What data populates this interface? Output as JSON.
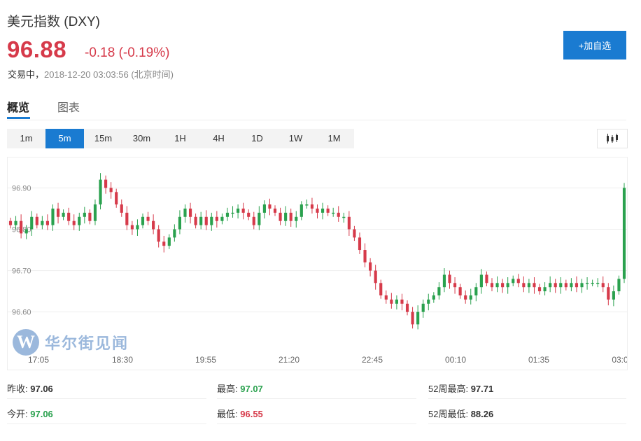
{
  "header": {
    "title": "美元指数 (DXY)",
    "price": "96.88",
    "change": "-0.18 (-0.19%)",
    "status_label": "交易中，",
    "timestamp": "2018-12-20 03:03:56 (北京时间)",
    "add_button": "+加自选"
  },
  "tabs": [
    {
      "label": "概览"
    },
    {
      "label": "图表"
    }
  ],
  "periods": [
    "1m",
    "5m",
    "15m",
    "30m",
    "1H",
    "4H",
    "1D",
    "1W",
    "1M"
  ],
  "active_period": "5m",
  "watermark": {
    "logo_letter": "W",
    "text": "华尔街见闻"
  },
  "colors": {
    "up": "#2aa14e",
    "down": "#d63a4a",
    "accent": "#1a7bd1",
    "price": "#d63a4a"
  },
  "stats": {
    "prev_close_label": "昨收:",
    "prev_close": "97.06",
    "open_label": "今开:",
    "open": "97.06",
    "high_label": "最高:",
    "high": "97.07",
    "low_label": "最低:",
    "low": "96.55",
    "high52_label": "52周最高:",
    "high52": "97.71",
    "low52_label": "52周最低:",
    "low52": "88.26"
  },
  "chart_data": {
    "type": "candlestick",
    "y_ticks": [
      "96.90",
      "96.80",
      "96.70",
      "96.60"
    ],
    "x_ticks": [
      "17:05",
      "18:30",
      "19:55",
      "21:20",
      "22:45",
      "00:10",
      "01:35",
      "03:0"
    ],
    "ylim": [
      96.53,
      96.96
    ],
    "grid": true,
    "closes": [
      96.81,
      96.82,
      96.79,
      96.8,
      96.83,
      96.81,
      96.82,
      96.81,
      96.85,
      96.83,
      96.84,
      96.82,
      96.81,
      96.83,
      96.84,
      96.82,
      96.86,
      96.92,
      96.9,
      96.89,
      96.86,
      96.84,
      96.81,
      96.8,
      96.81,
      96.83,
      96.82,
      96.8,
      96.77,
      96.76,
      96.78,
      96.8,
      96.83,
      96.85,
      96.83,
      96.81,
      96.83,
      96.81,
      96.83,
      96.82,
      96.83,
      96.84,
      96.84,
      96.85,
      96.84,
      96.83,
      96.81,
      96.84,
      96.86,
      96.85,
      96.84,
      96.82,
      96.84,
      96.82,
      96.83,
      96.86,
      96.86,
      96.85,
      96.84,
      96.85,
      96.84,
      96.84,
      96.83,
      96.83,
      96.8,
      96.78,
      96.75,
      96.72,
      96.7,
      96.67,
      96.64,
      96.63,
      96.62,
      96.63,
      96.62,
      96.6,
      96.57,
      96.6,
      96.62,
      96.63,
      96.64,
      96.66,
      96.69,
      96.67,
      96.66,
      96.64,
      96.63,
      96.64,
      96.66,
      96.69,
      96.67,
      96.66,
      96.67,
      96.66,
      96.67,
      96.68,
      96.67,
      96.66,
      96.67,
      96.66,
      96.65,
      96.66,
      96.67,
      96.66,
      96.67,
      96.66,
      96.67,
      96.66,
      96.67,
      96.67,
      96.67,
      96.67,
      96.66,
      96.63,
      96.65,
      96.68,
      96.9
    ]
  }
}
